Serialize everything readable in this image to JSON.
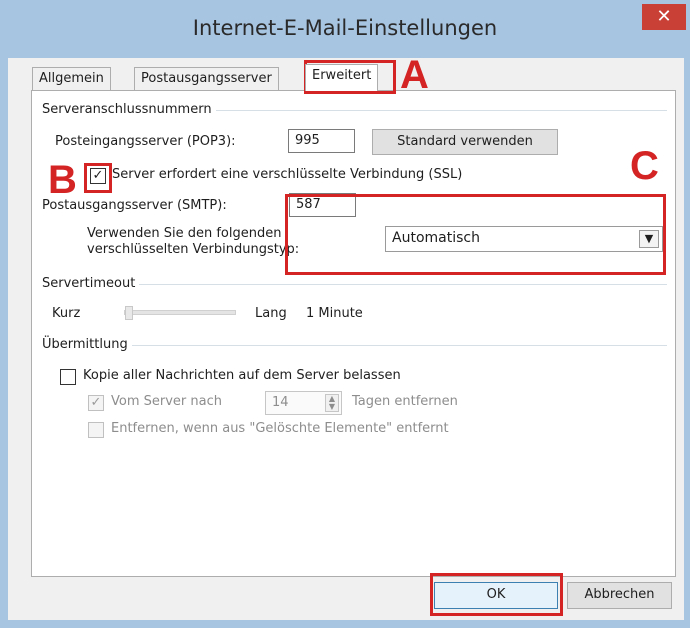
{
  "window": {
    "title": "Internet-E-Mail-Einstellungen",
    "close_label": "✕"
  },
  "tabs": [
    {
      "label": "Allgemein",
      "active": false
    },
    {
      "label": "Postausgangsserver",
      "active": false
    },
    {
      "label": "Erweitert",
      "active": true
    }
  ],
  "groups": {
    "ports": "Serveranschlussnummern",
    "timeout": "Servertimeout",
    "delivery": "Übermittlung"
  },
  "ports": {
    "incoming_label": "Posteingangsserver (POP3):",
    "incoming_value": "995",
    "default_button": "Standard verwenden",
    "ssl_checkbox_label": "Server erfordert eine verschlüsselte Verbindung (SSL)",
    "ssl_checked": true,
    "outgoing_label": "Postausgangsserver (SMTP):",
    "outgoing_value": "587",
    "encryption_label_line1": "Verwenden Sie den folgenden",
    "encryption_label_line2": "verschlüsselten Verbindungstyp:",
    "encryption_value": "Automatisch"
  },
  "timeout": {
    "short_label": "Kurz",
    "long_label": "Lang",
    "value_text": "1 Minute",
    "slider_level": 0
  },
  "delivery": {
    "keep_copy_label": "Kopie aller Nachrichten auf dem Server belassen",
    "keep_copy_checked": false,
    "remove_after_label": "Vom Server nach",
    "remove_after_checked": true,
    "days_value": "14",
    "days_suffix": "Tagen entfernen",
    "remove_deleted_label": "Entfernen, wenn aus \"Gelöschte Elemente\" entfernt",
    "remove_deleted_checked": false
  },
  "footer": {
    "ok_label": "OK",
    "cancel_label": "Abbrechen"
  },
  "annotations": {
    "a": "A",
    "b": "B",
    "c": "C",
    "color": "#d42424"
  },
  "icons": {
    "close": "close-icon",
    "checkmark": "checkmark-icon",
    "dropdown": "chevron-down-icon",
    "spin": "spin-arrows-icon"
  }
}
